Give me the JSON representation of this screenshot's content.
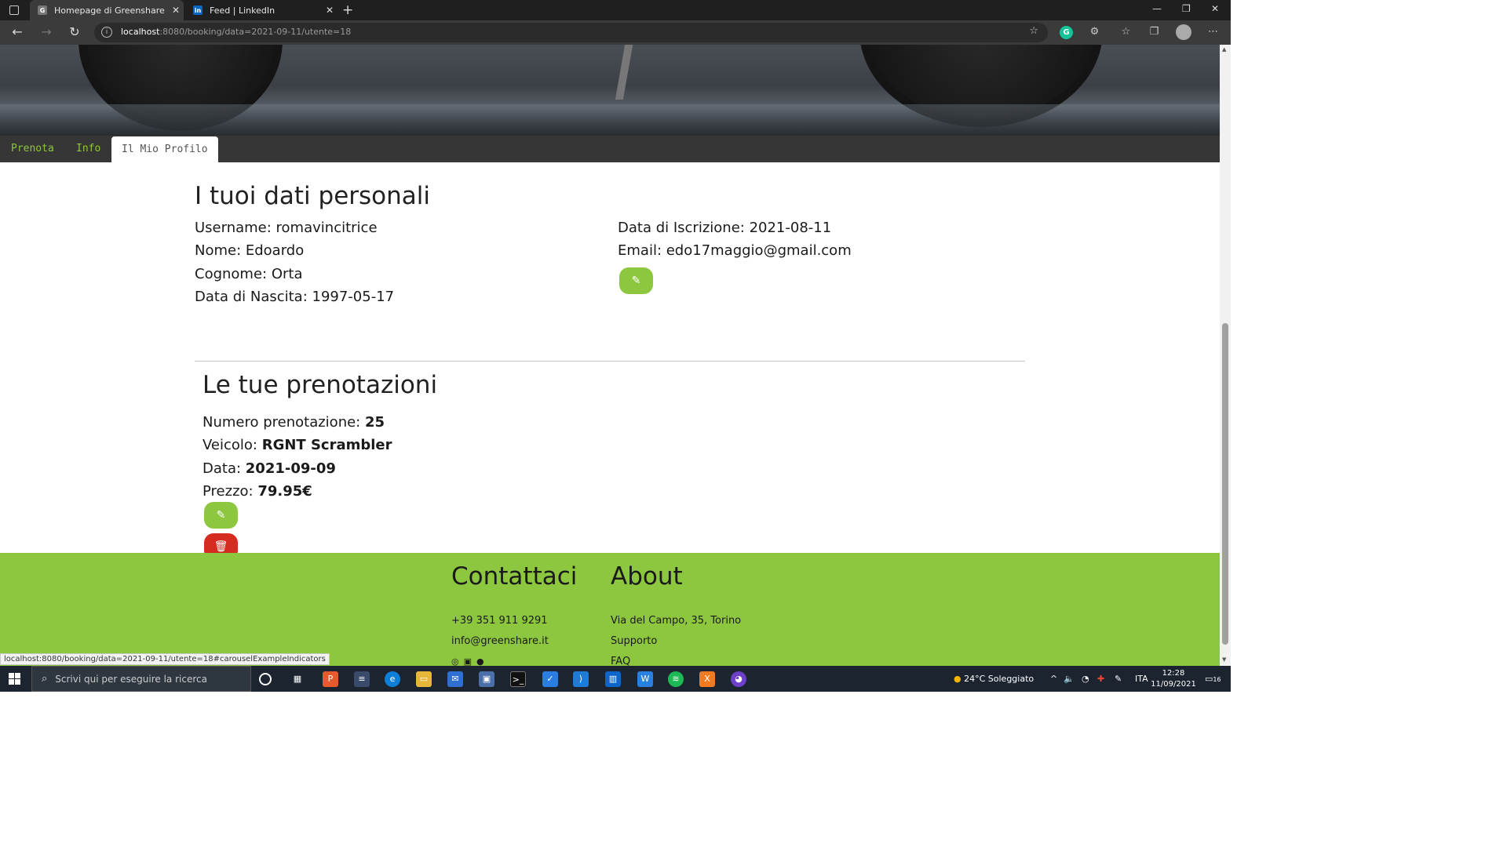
{
  "browser": {
    "tabs": [
      {
        "label": "Homepage di Greenshare",
        "favicon": "greenshare-favicon"
      },
      {
        "label": "Feed | LinkedIn",
        "favicon": "linkedin-favicon"
      }
    ],
    "url_host": "localhost",
    "url_path": ":8080/booking/data=2021-09-11/utente=18",
    "status_url": "localhost:8080/booking/data=2021-09-11/utente=18#carouselExampleIndicators"
  },
  "menu": {
    "items": [
      {
        "label": "Prenota"
      },
      {
        "label": "Info"
      },
      {
        "label": "Il Mio Profilo"
      }
    ],
    "active_color": "#8dc63f"
  },
  "profile": {
    "title": "I tuoi dati personali",
    "username": "Username: romavincitrice",
    "nome": "Nome: Edoardo",
    "cognome": "Cognome: Orta",
    "nascita": "Data di Nascita: 1997-05-17",
    "iscrizione": "Data di Iscrizione: 2021-08-11",
    "email": "Email: edo17maggio@gmail.com",
    "edit_icon": "edit-icon"
  },
  "bookings": {
    "title": "Le tue prenotazioni",
    "items": [
      {
        "numero_label": "Numero prenotazione:",
        "numero": "25",
        "veicolo_label": "Veicolo:",
        "veicolo": "RGNT Scrambler",
        "data_label": "Data:",
        "data": "2021-09-09",
        "prezzo_label": "Prezzo:",
        "prezzo": "79.95€"
      }
    ],
    "edit_icon": "edit-icon",
    "delete_icon": "trash-icon",
    "delete_color": "#d62b1f"
  },
  "footer": {
    "contact_title": "Contattaci",
    "phone": "+39 351 911 9291",
    "email": "info@greenshare.it",
    "about_title": "About",
    "address": "Via del Campo, 35, Torino",
    "support": "Supporto",
    "faq": "FAQ",
    "bg_color": "#8dc63f"
  },
  "taskbar": {
    "search_placeholder": "Scrivi qui per eseguire la ricerca",
    "weather": "24°C  Soleggiato",
    "language": "ITA",
    "time": "12:28",
    "date": "11/09/2021",
    "notifications": "16"
  }
}
